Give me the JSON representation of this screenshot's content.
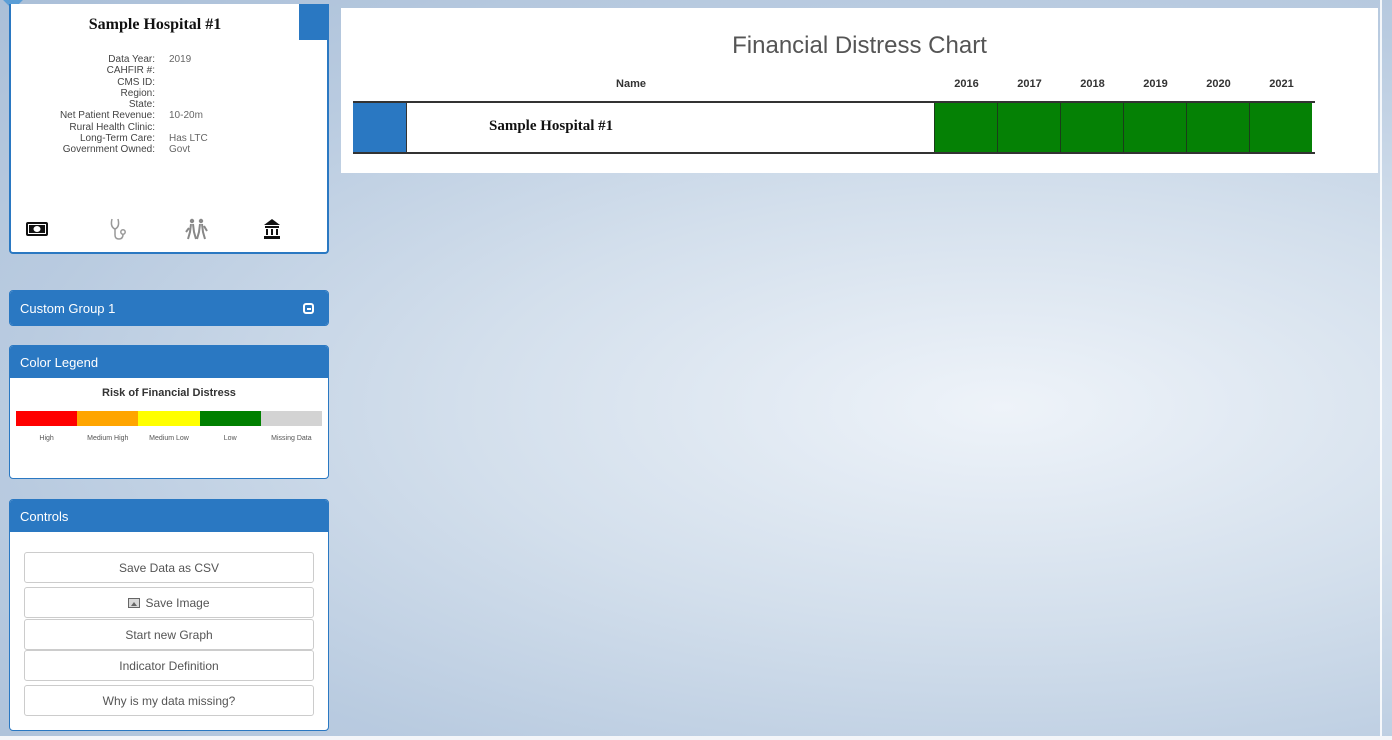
{
  "hospital": {
    "name": "Sample Hospital #1",
    "fields": [
      {
        "label": "Data Year:",
        "value": "2019"
      },
      {
        "label": "CAHFIR #:",
        "value": ""
      },
      {
        "label": "CMS ID:",
        "value": ""
      },
      {
        "label": "Region:",
        "value": ""
      },
      {
        "label": "State:",
        "value": ""
      },
      {
        "label": "Net Patient Revenue:",
        "value": "10-20m"
      },
      {
        "label": "Rural Health Clinic:",
        "value": ""
      },
      {
        "label": "Long-Term Care:",
        "value": "Has LTC"
      },
      {
        "label": "Government Owned:",
        "value": "Govt"
      }
    ],
    "icons": [
      "money-icon",
      "stethoscope-icon",
      "elderly-care-icon",
      "government-building-icon"
    ]
  },
  "custom_group": {
    "label": "Custom Group 1"
  },
  "legend": {
    "header": "Color Legend",
    "title": "Risk of Financial Distress",
    "items": [
      {
        "label": "High",
        "color": "#ff0000"
      },
      {
        "label": "Medium High",
        "color": "#ffa500"
      },
      {
        "label": "Medium Low",
        "color": "#ffff00"
      },
      {
        "label": "Low",
        "color": "#008000"
      },
      {
        "label": "Missing Data",
        "color": "#d3d3d3"
      }
    ]
  },
  "controls": {
    "header": "Controls",
    "buttons": [
      "Save Data as CSV",
      "Save Image",
      "Start new Graph",
      "Indicator Definition",
      "Why is my data missing?"
    ]
  },
  "chart": {
    "title": "Financial Distress Chart",
    "name_header": "Name",
    "years": [
      "2016",
      "2017",
      "2018",
      "2019",
      "2020",
      "2021"
    ],
    "rows": [
      {
        "name": "Sample Hospital #1",
        "flag_color": "#2a78c2",
        "risk": [
          "Low",
          "Low",
          "Low",
          "Low",
          "Low",
          "Low"
        ]
      }
    ]
  }
}
